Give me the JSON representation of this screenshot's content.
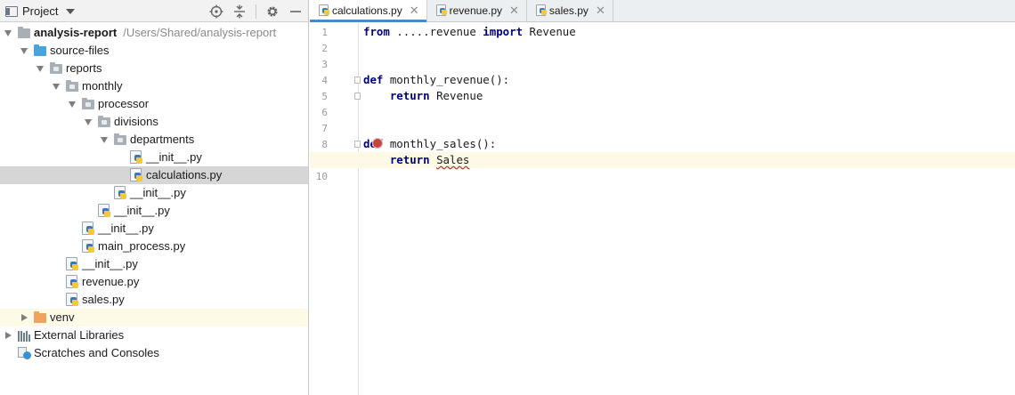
{
  "project_pane": {
    "title": "Project",
    "tools": [
      {
        "name": "locate",
        "icon": "crosshair-icon"
      },
      {
        "name": "collapse",
        "icon": "collapse-all-icon"
      },
      {
        "name": "settings",
        "icon": "gear-icon"
      },
      {
        "name": "hide",
        "icon": "minimize-icon"
      }
    ]
  },
  "tree": [
    {
      "label": "analysis-report",
      "hint": "/Users/Shared/analysis-report",
      "bold": true,
      "depth": 0,
      "icon": "folder",
      "expanded": true
    },
    {
      "label": "source-files",
      "depth": 1,
      "icon": "folder-blue",
      "expanded": true
    },
    {
      "label": "reports",
      "depth": 2,
      "icon": "package-folder",
      "expanded": true
    },
    {
      "label": "monthly",
      "depth": 3,
      "icon": "package-folder",
      "expanded": true
    },
    {
      "label": "processor",
      "depth": 4,
      "icon": "package-folder",
      "expanded": true
    },
    {
      "label": "divisions",
      "depth": 5,
      "icon": "package-folder",
      "expanded": true
    },
    {
      "label": "departments",
      "depth": 6,
      "icon": "package-folder",
      "expanded": true
    },
    {
      "label": "__init__.py",
      "depth": 7,
      "icon": "python-file"
    },
    {
      "label": "calculations.py",
      "depth": 7,
      "icon": "python-file",
      "selected": true
    },
    {
      "label": "__init__.py",
      "depth": 6,
      "icon": "python-file"
    },
    {
      "label": "__init__.py",
      "depth": 5,
      "icon": "python-file"
    },
    {
      "label": "__init__.py",
      "depth": 4,
      "icon": "python-file"
    },
    {
      "label": "main_process.py",
      "depth": 4,
      "icon": "python-file"
    },
    {
      "label": "__init__.py",
      "depth": 3,
      "icon": "python-file"
    },
    {
      "label": "revenue.py",
      "depth": 3,
      "icon": "python-file"
    },
    {
      "label": "sales.py",
      "depth": 3,
      "icon": "python-file"
    },
    {
      "label": "venv",
      "depth": 1,
      "icon": "folder-orange",
      "expanded": false,
      "excluded": true
    },
    {
      "label": "External Libraries",
      "depth": 0,
      "icon": "libraries",
      "expanded": false
    },
    {
      "label": "Scratches and Consoles",
      "depth": 0,
      "icon": "scratches"
    }
  ],
  "tabs": [
    {
      "label": "calculations.py",
      "active": true
    },
    {
      "label": "revenue.py",
      "active": false
    },
    {
      "label": "sales.py",
      "active": false
    }
  ],
  "code": {
    "line_numbers": [
      "1",
      "2",
      "3",
      "4",
      "5",
      "6",
      "7",
      "8",
      "9",
      "10"
    ],
    "lines": [
      [
        {
          "t": "from",
          "k": true
        },
        {
          "t": " .....revenue "
        },
        {
          "t": "import",
          "k": true
        },
        {
          "t": " Revenue"
        }
      ],
      [],
      [],
      [
        {
          "t": "def",
          "k": true
        },
        {
          "t": " monthly_revenue():"
        }
      ],
      [
        {
          "t": "    "
        },
        {
          "t": "return",
          "k": true
        },
        {
          "t": " Revenue"
        }
      ],
      [],
      [],
      [
        {
          "t": "def",
          "k": true
        },
        {
          "t": " monthly_sales():"
        }
      ],
      [
        {
          "t": "    "
        },
        {
          "t": "return",
          "k": true
        },
        {
          "t": " "
        },
        {
          "t": "Sales",
          "err": true
        }
      ],
      []
    ],
    "current_line": 9,
    "fold_lines": [
      4,
      5,
      8,
      9
    ],
    "error_marker_line": 8
  }
}
